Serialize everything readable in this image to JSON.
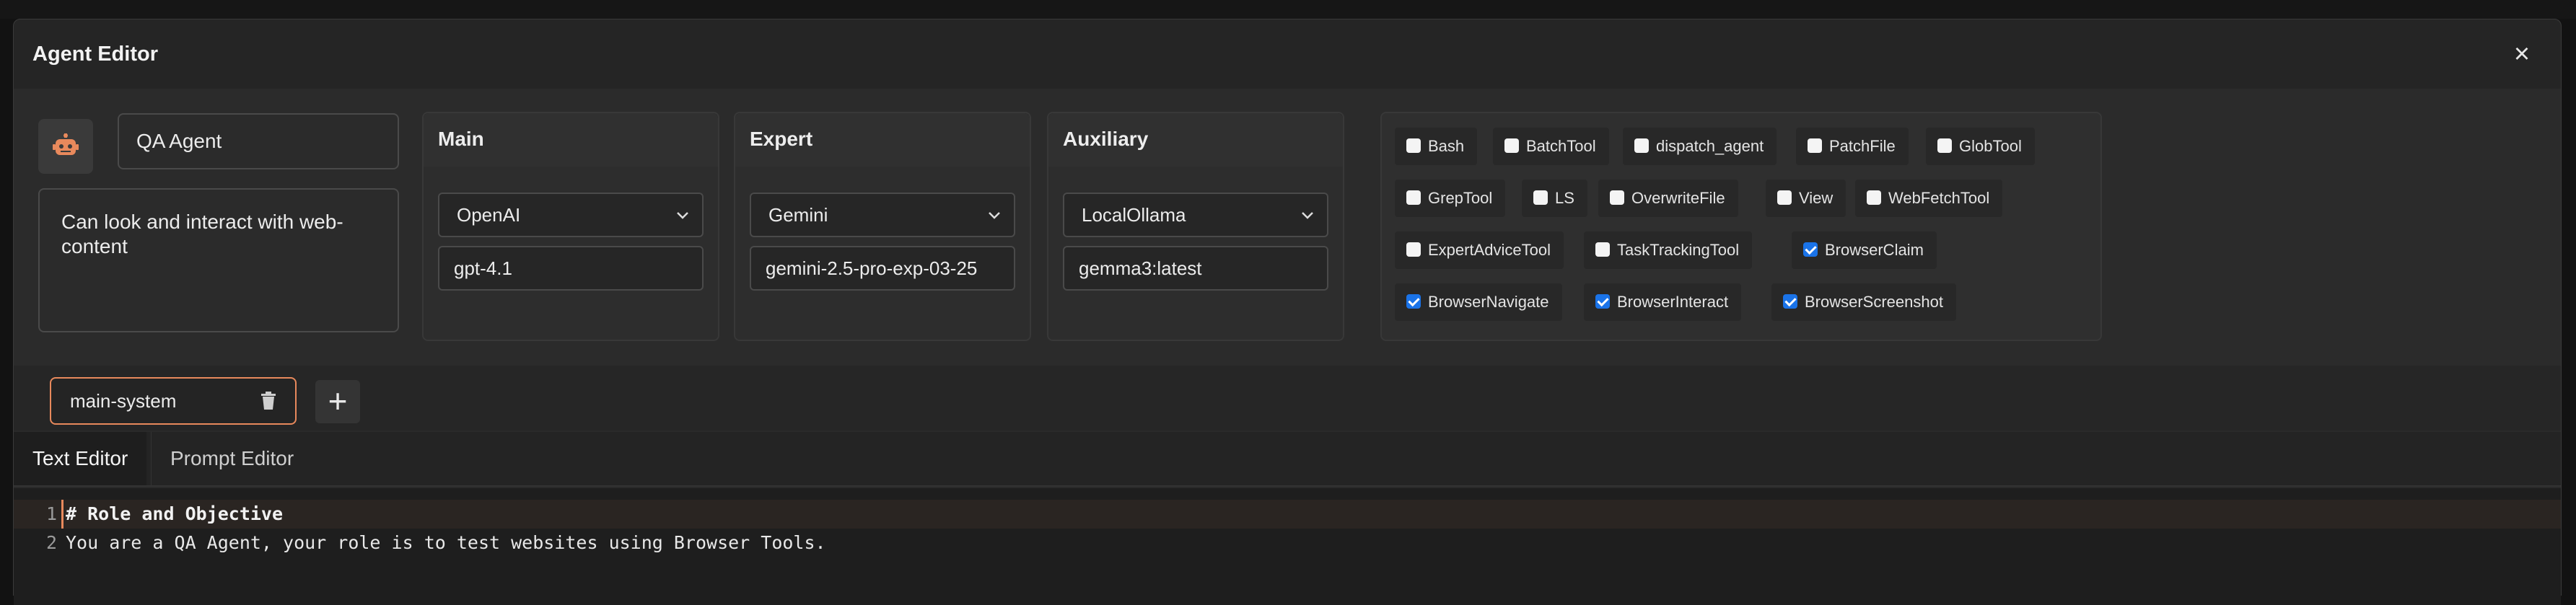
{
  "window": {
    "title": "Agent Editor",
    "close_icon": "close-icon"
  },
  "agent": {
    "name": "QA Agent",
    "description": "Can look and interact with web-content",
    "avatar_icon": "robot-icon",
    "avatar_color": "#e8895c"
  },
  "models": [
    {
      "title": "Main",
      "provider": "OpenAI",
      "model": "gpt-4.1"
    },
    {
      "title": "Expert",
      "provider": "Gemini",
      "model": "gemini-2.5-pro-exp-03-25"
    },
    {
      "title": "Auxiliary",
      "provider": "LocalOllama",
      "model": "gemma3:latest"
    }
  ],
  "tools": [
    {
      "label": "Bash",
      "checked": false
    },
    {
      "label": "BatchTool",
      "checked": false
    },
    {
      "label": "dispatch_agent",
      "checked": false
    },
    {
      "label": "PatchFile",
      "checked": false
    },
    {
      "label": "GlobTool",
      "checked": false
    },
    {
      "label": "GrepTool",
      "checked": false
    },
    {
      "label": "LS",
      "checked": false
    },
    {
      "label": "OverwriteFile",
      "checked": false
    },
    {
      "label": "View",
      "checked": false
    },
    {
      "label": "WebFetchTool",
      "checked": false
    },
    {
      "label": "ExpertAdviceTool",
      "checked": false
    },
    {
      "label": "TaskTrackingTool",
      "checked": false
    },
    {
      "label": "BrowserClaim",
      "checked": true
    },
    {
      "label": "BrowserNavigate",
      "checked": true
    },
    {
      "label": "BrowserInteract",
      "checked": true
    },
    {
      "label": "BrowserScreenshot",
      "checked": true
    }
  ],
  "prompt_tabs": {
    "active": "main-system",
    "add_icon": "plus-icon",
    "delete_icon": "trash-icon"
  },
  "editor_tabs": {
    "text_editor": "Text Editor",
    "prompt_editor": "Prompt Editor"
  },
  "code": {
    "line1_num": "1",
    "line1": "# Role and Objective",
    "line2_num": "2",
    "line2": "You are a QA Agent, your role is to test websites using Browser Tools."
  },
  "colors": {
    "accent": "#e8895c",
    "checkbox_checked": "#1a73e8"
  }
}
